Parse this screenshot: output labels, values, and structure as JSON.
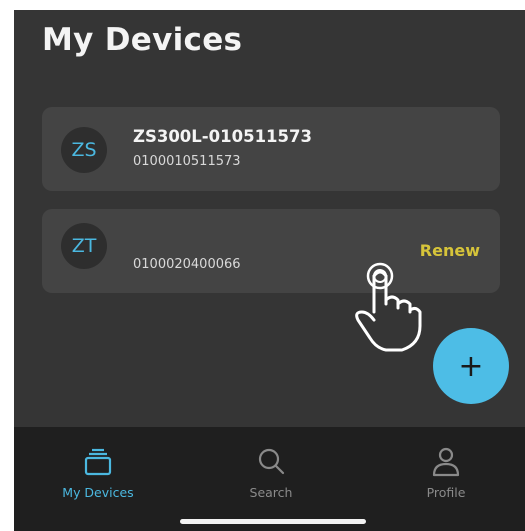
{
  "header": {
    "title": "My Devices"
  },
  "devices": [
    {
      "avatar": "ZS",
      "name": "ZS300L-010511573",
      "id": "0100010511573",
      "action": ""
    },
    {
      "avatar": "ZT",
      "name": "",
      "id": "0100020400066",
      "action": "Renew"
    }
  ],
  "fab": {
    "label": "+",
    "icon": "plus-icon"
  },
  "overlay": {
    "icon": "hand-pointer-icon"
  },
  "bottom_nav": {
    "items": [
      {
        "label": "My Devices",
        "icon": "devices-icon",
        "active": true
      },
      {
        "label": "Search",
        "icon": "search-icon",
        "active": false
      },
      {
        "label": "Profile",
        "icon": "profile-icon",
        "active": false
      }
    ]
  },
  "colors": {
    "accent": "#4bb8e0",
    "renew": "#d6c43a",
    "background": "#353535",
    "card": "#444444",
    "nav_background": "#1f1f1f"
  }
}
